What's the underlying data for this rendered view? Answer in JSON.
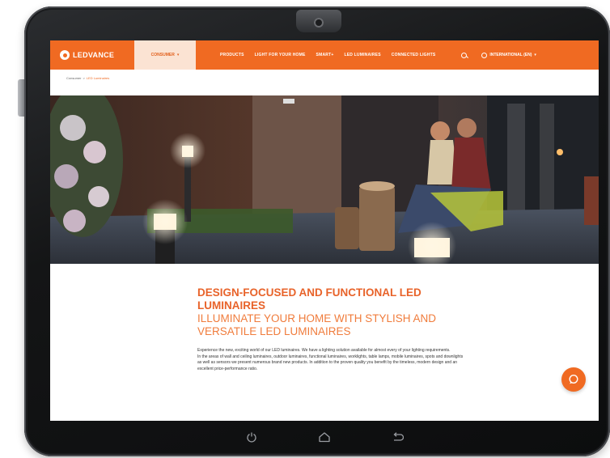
{
  "header": {
    "logo_text": "LEDVANCE",
    "active_tab": "CONSUMER",
    "nav_links": [
      "PRODUCTS",
      "LIGHT FOR YOUR HOME",
      "SMART+",
      "LED LUMINAIRES",
      "CONNECTED LIGHTS"
    ],
    "region": "INTERNATIONAL (EN)"
  },
  "breadcrumb": {
    "home": "Consumer",
    "separator": ">",
    "current": "LED Luminaires"
  },
  "content": {
    "heading_bold": "DESIGN-FOCUSED AND FUNCTIONAL LED LUMINAIRES",
    "heading_light": "ILLUMINATE YOUR HOME WITH STYLISH AND VERSATILE LED LUMINAIRES",
    "paragraph_1": "Experience the new, exciting world of our LED luminaires. We have a lighting solution available for almost every of your lighting requirements.",
    "paragraph_2": "In the areas of wall and ceiling luminaires, outdoor luminaires, functional luminaires, worklights, table lamps, mobile luminaires, spots and downlights as well as sensors we present numerous brand new products. In addition to the proven quality you benefit by the timeless, modern design and an excellent price-performance ratio."
  },
  "icons": {
    "chat": "chat-icon",
    "search": "search-icon",
    "globe": "globe-icon",
    "power": "power-icon",
    "home": "home-icon",
    "back": "back-icon"
  },
  "colors": {
    "brand_orange": "#f06a22",
    "heading_orange": "#e8632a",
    "device_black": "#141516"
  }
}
